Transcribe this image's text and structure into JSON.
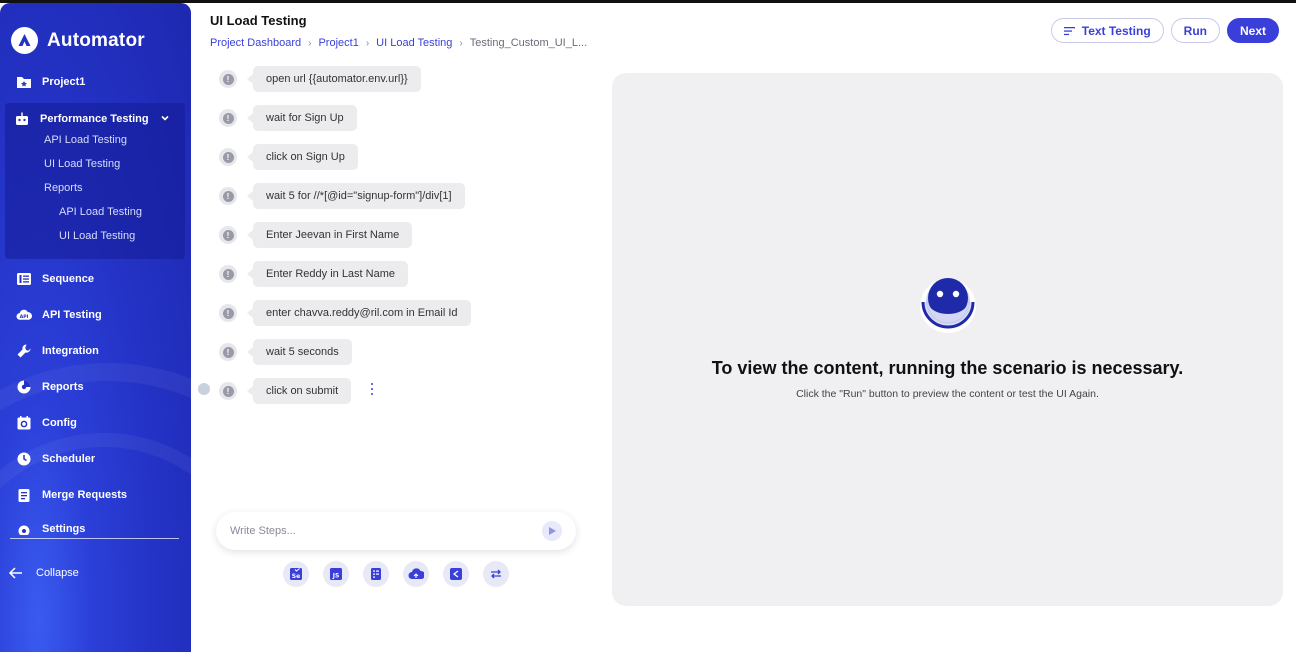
{
  "app": {
    "name": "Automator"
  },
  "sidebar": {
    "project": "Project1",
    "group": {
      "label": "Performance Testing",
      "items": [
        "API Load Testing",
        "UI Load Testing",
        "Reports"
      ],
      "sub_items": [
        "API Load Testing",
        "UI Load Testing"
      ]
    },
    "items": [
      "Sequence",
      "API Testing",
      "Integration",
      "Reports",
      "Config",
      "Scheduler",
      "Merge Requests",
      "Settings"
    ],
    "collapse": "Collapse"
  },
  "header": {
    "title": "UI Load Testing",
    "breadcrumb": [
      "Project Dashboard",
      "Project1",
      "UI Load Testing",
      "Testing_Custom_UI_L..."
    ],
    "actions": {
      "text_testing": "Text Testing",
      "run": "Run",
      "next": "Next"
    }
  },
  "steps": [
    "open url {{automator.env.url}}",
    "wait for Sign Up",
    "click on Sign Up",
    "wait 5 for //*[@id=\"signup-form\"]/div[1]",
    "Enter Jeevan in First Name",
    "Enter Reddy in Last Name",
    "enter chavva.reddy@ril.com in Email Id",
    "wait 5 seconds",
    "click on submit"
  ],
  "composer": {
    "placeholder": "Write Steps..."
  },
  "tools": [
    "selenium-icon",
    "javascript-icon",
    "checklist-icon",
    "cloud-sync-icon",
    "share-icon",
    "swap-icon"
  ],
  "preview": {
    "title": "To view the content, running the scenario is necessary.",
    "subtitle": "Click the \"Run\" button to preview the content or test the UI Again."
  },
  "colors": {
    "accent": "#3a3fd9",
    "sidebar": "#2433c6",
    "panel": "#f0f0f2"
  }
}
